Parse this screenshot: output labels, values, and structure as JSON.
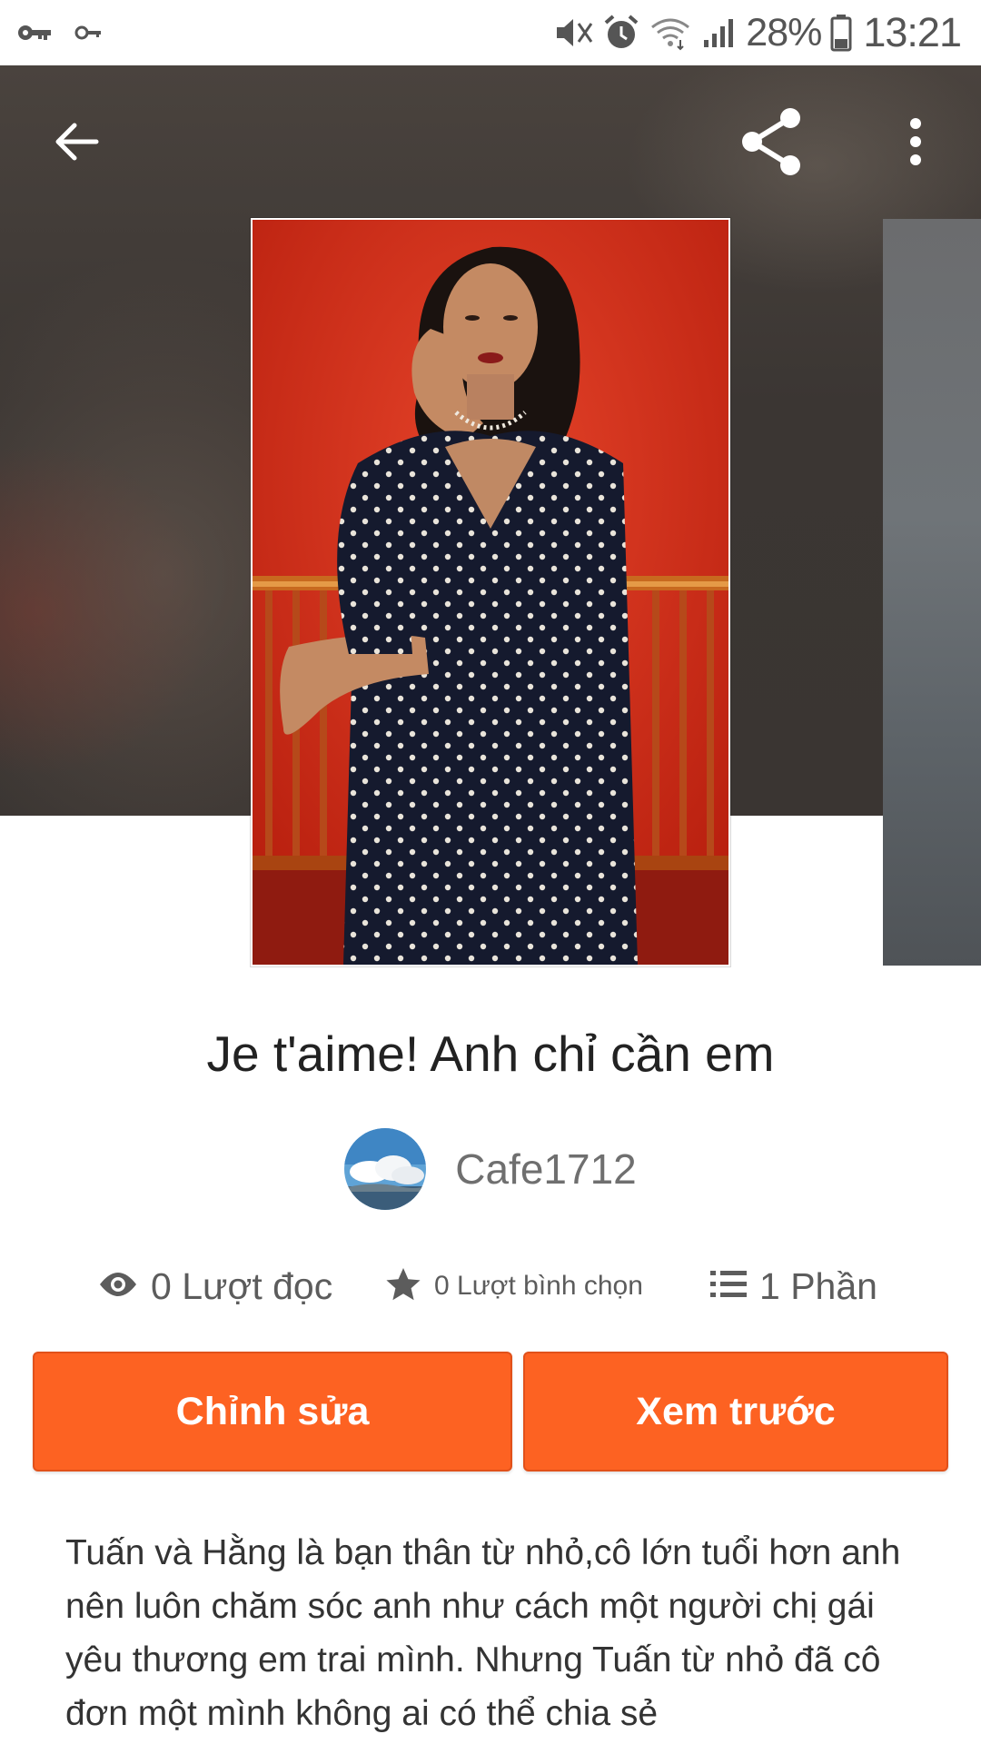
{
  "status_bar": {
    "battery_percent": "28%",
    "time": "13:21",
    "icons": [
      "key-icon",
      "key-small-icon",
      "mute-icon",
      "alarm-icon",
      "wifi-icon",
      "signal-icon",
      "battery-icon"
    ]
  },
  "header": {
    "icons": [
      "back-arrow-icon",
      "share-icon",
      "more-vertical-icon"
    ]
  },
  "story": {
    "title": "Je t'aime! Anh chỉ cần em",
    "author": "Cafe1712",
    "stats": {
      "reads": "0 Lượt đọc",
      "votes": "0 Lượt bình chọn",
      "parts": "1 Phần"
    },
    "description": "Tuấn và Hằng là bạn thân từ nhỏ,cô lớn tuổi hơn anh nên luôn chăm sóc anh như cách một người chị gái yêu thương em trai mình. Nhưng Tuấn từ nhỏ đã cô đơn một mình không ai có thể chia sẻ"
  },
  "actions": {
    "edit_label": "Chỉnh sửa",
    "preview_label": "Xem trước"
  },
  "colors": {
    "accent": "#fd6222",
    "cover_background": "#d62f1c",
    "hero_background": "#3b3633"
  }
}
